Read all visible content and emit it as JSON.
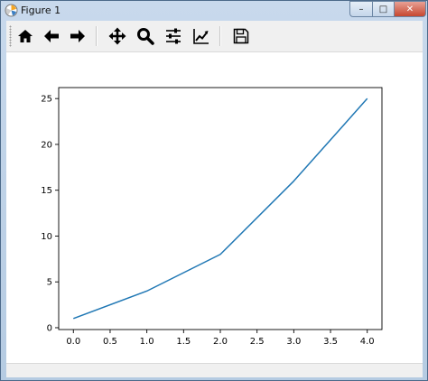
{
  "window": {
    "title": "Figure 1",
    "minimize_glyph": "–",
    "maximize_glyph": "□",
    "close_glyph": "✕"
  },
  "toolbar": {
    "buttons": [
      {
        "name": "home-icon"
      },
      {
        "name": "back-arrow-icon"
      },
      {
        "name": "forward-arrow-icon"
      },
      {
        "name": "pan-icon"
      },
      {
        "name": "zoom-icon"
      },
      {
        "name": "configure-subplots-icon"
      },
      {
        "name": "edit-axis-icon"
      },
      {
        "name": "save-icon"
      }
    ]
  },
  "colors": {
    "line": "#1f77b4",
    "axes": "#000000"
  },
  "chart_data": {
    "type": "line",
    "x": [
      0,
      1,
      2,
      3,
      4
    ],
    "series": [
      {
        "values": [
          1,
          4,
          8,
          16,
          25
        ]
      }
    ],
    "xlim": [
      -0.2,
      4.2
    ],
    "ylim": [
      -0.2,
      26.2
    ],
    "xticks": [
      0.0,
      0.5,
      1.0,
      1.5,
      2.0,
      2.5,
      3.0,
      3.5,
      4.0
    ],
    "xtick_labels": [
      "0.0",
      "0.5",
      "1.0",
      "1.5",
      "2.0",
      "2.5",
      "3.0",
      "3.5",
      "4.0"
    ],
    "yticks": [
      0,
      5,
      10,
      15,
      20,
      25
    ],
    "ytick_labels": [
      "0",
      "5",
      "10",
      "15",
      "20",
      "25"
    ],
    "grid": false
  }
}
